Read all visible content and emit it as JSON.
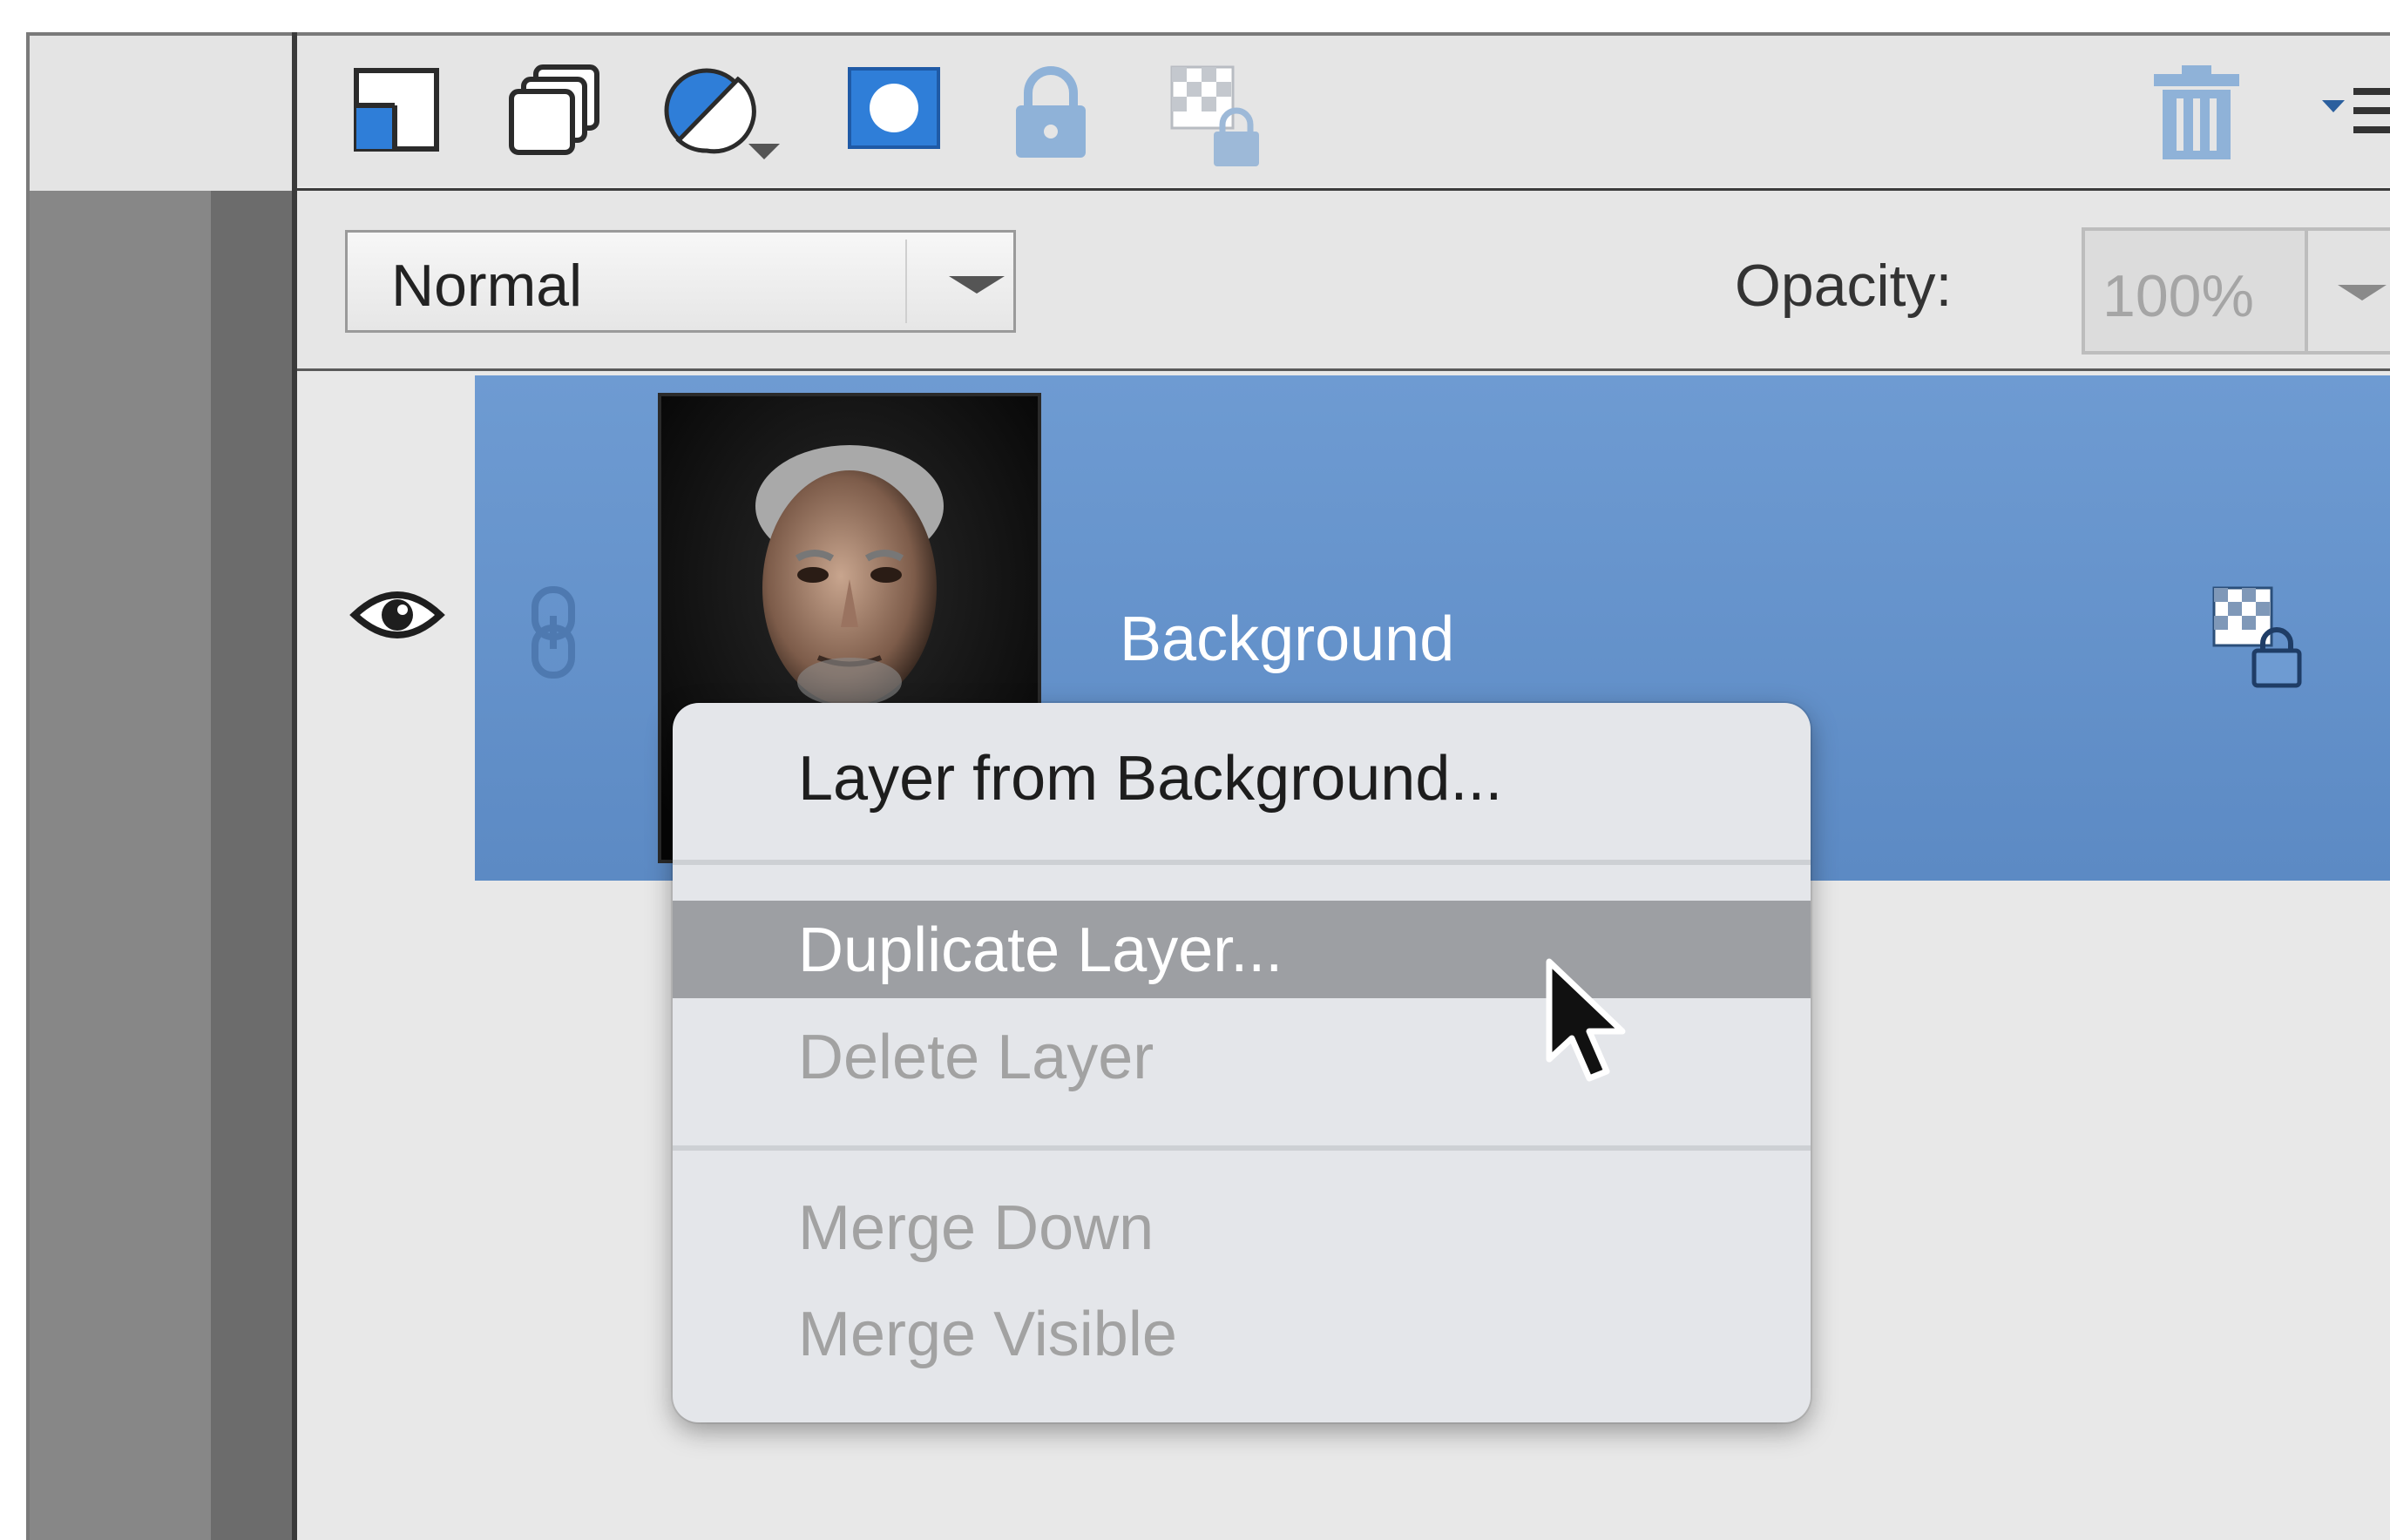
{
  "toolbar": {
    "icons": [
      "new-layer-icon",
      "new-group-icon",
      "adjustment-layer-icon",
      "layer-mask-icon",
      "lock-all-icon",
      "lock-transparency-icon",
      "trash-icon",
      "panel-menu-icon"
    ]
  },
  "blend_mode": {
    "selected": "Normal"
  },
  "opacity": {
    "label": "Opacity:",
    "value": "100%"
  },
  "layer": {
    "name": "Background",
    "visible": true
  },
  "context_menu": {
    "items": [
      {
        "label": "Layer from Background...",
        "enabled": true
      },
      {
        "label": "Duplicate Layer...",
        "enabled": true,
        "highlighted": true
      },
      {
        "label": "Delete Layer",
        "enabled": false
      },
      {
        "label": "Merge Down",
        "enabled": false
      },
      {
        "label": "Merge Visible",
        "enabled": false
      }
    ]
  },
  "colors": {
    "selection": "#6593cc",
    "menu_background": "#e4e6ea",
    "menu_highlight": "#9d9fa3",
    "accent_icon": "#2f7ed8"
  }
}
